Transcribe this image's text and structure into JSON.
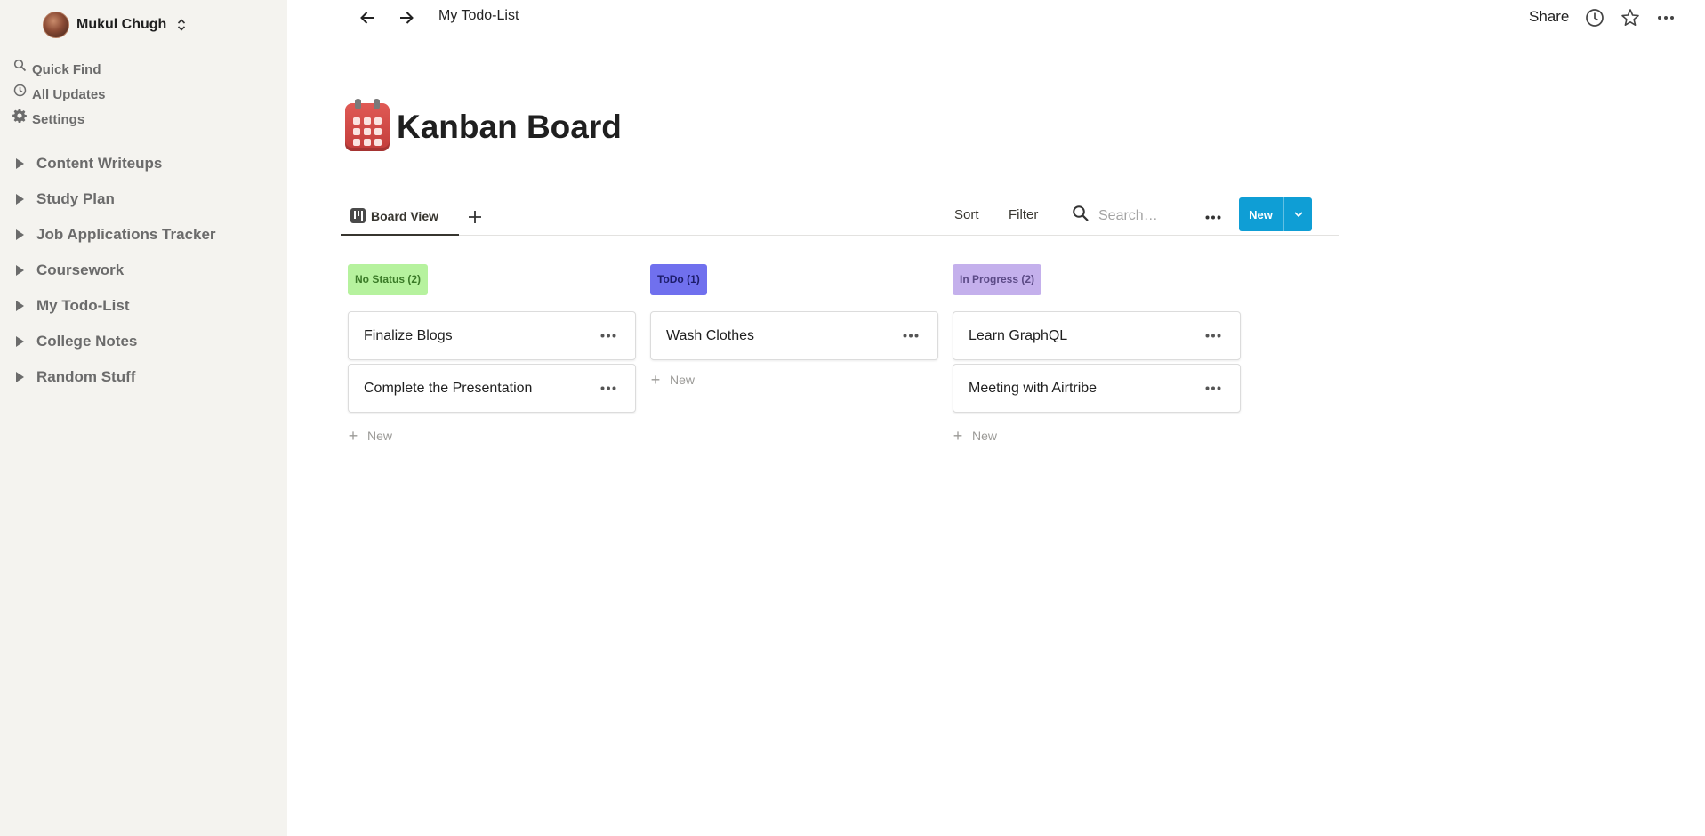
{
  "sidebar": {
    "workspace_name": "Mukul Chugh",
    "quick_links": [
      {
        "label": "Quick Find",
        "icon": "search-icon"
      },
      {
        "label": "All Updates",
        "icon": "clock-icon"
      },
      {
        "label": "Settings",
        "icon": "gear-icon"
      }
    ],
    "pages": [
      {
        "label": "Content Writeups"
      },
      {
        "label": "Study Plan"
      },
      {
        "label": "Job Applications Tracker"
      },
      {
        "label": "Coursework"
      },
      {
        "label": "My Todo-List"
      },
      {
        "label": "College Notes"
      },
      {
        "label": "Random Stuff"
      }
    ]
  },
  "topbar": {
    "breadcrumb": "My Todo-List",
    "share_label": "Share"
  },
  "page": {
    "title": "Kanban Board",
    "icon": "calendar-icon"
  },
  "viewbar": {
    "tab_label": "Board View",
    "sort_label": "Sort",
    "filter_label": "Filter",
    "search_placeholder": "Search…",
    "new_label": "New"
  },
  "board": {
    "columns": [
      {
        "header": "No Status (2)",
        "header_bg": "#b6f29e",
        "header_color": "#3a7a27",
        "cards": [
          "Finalize Blogs",
          "Complete the Presentation"
        ],
        "new_label": "New"
      },
      {
        "header": "ToDo (1)",
        "header_bg": "#7070ee",
        "header_color": "#1d1d6b",
        "cards": [
          "Wash Clothes"
        ],
        "new_label": "New"
      },
      {
        "header": "In Progress (2)",
        "header_bg": "#c4b0ec",
        "header_color": "#5b4a86",
        "cards": [
          "Learn GraphQL",
          "Meeting with Airtribe"
        ],
        "new_label": "New"
      }
    ]
  },
  "colors": {
    "accent": "#0f9ed5",
    "sidebar_bg": "#f4f3ef"
  }
}
